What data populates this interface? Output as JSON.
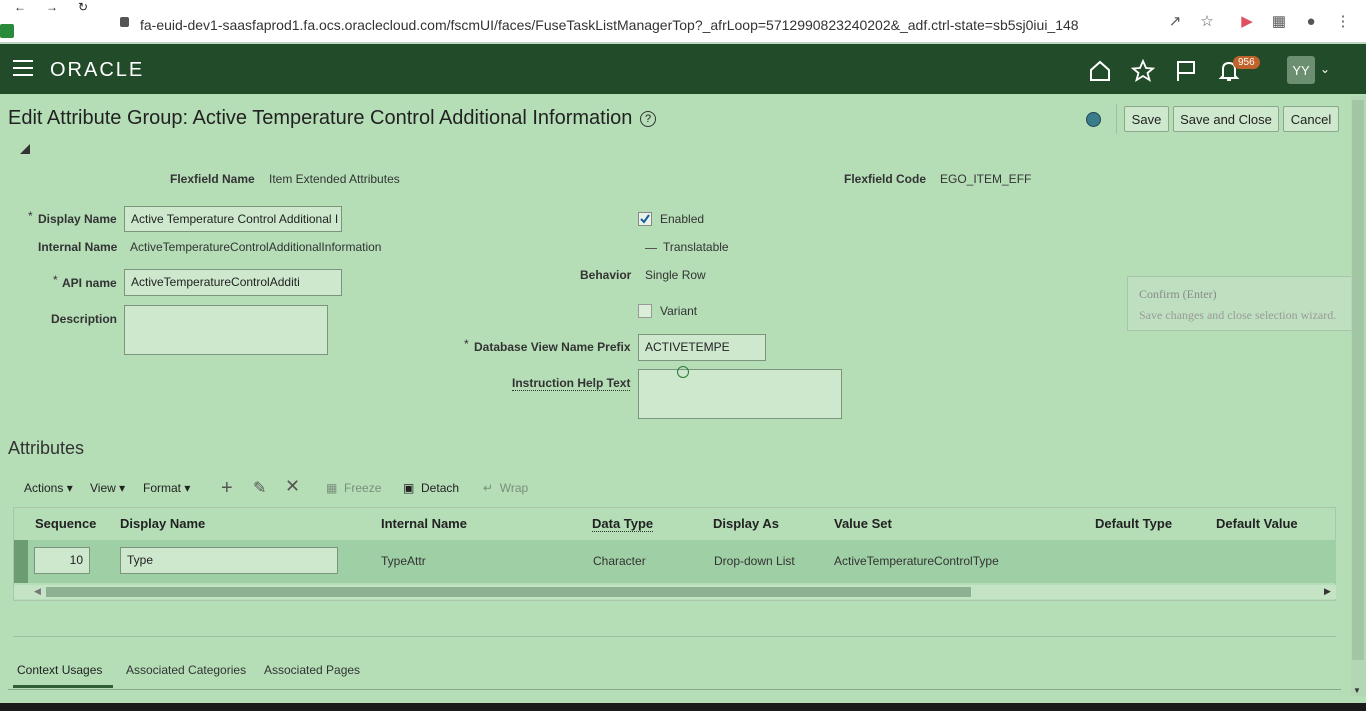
{
  "browser": {
    "url": "fa-euid-dev1-saasfaprod1.fa.ocs.oraclecloud.com/fscmUI/faces/FuseTaskListManagerTop?_afrLoop=5712990823240202&_adf.ctrl-state=sb5sj0iui_148"
  },
  "header": {
    "logo": "ORACLE",
    "notification_count": "956",
    "user_initials": "YY"
  },
  "page": {
    "title": "Edit Attribute Group: Active Temperature Control Additional Information",
    "save_label": "Save",
    "save_close_label": "Save and Close",
    "cancel_label": "Cancel"
  },
  "form": {
    "flexfield_name_label": "Flexfield Name",
    "flexfield_name_value": "Item Extended Attributes",
    "flexfield_code_label": "Flexfield Code",
    "flexfield_code_value": "EGO_ITEM_EFF",
    "display_name_label": "Display Name",
    "display_name_value": "Active Temperature Control Additional I",
    "internal_name_label": "Internal Name",
    "internal_name_value": "ActiveTemperatureControlAdditionalInformation",
    "api_name_label": "API name",
    "api_name_value": "ActiveTemperatureControlAdditi",
    "description_label": "Description",
    "enabled_label": "Enabled",
    "translatable_label": "Translatable",
    "behavior_label": "Behavior",
    "behavior_value": "Single Row",
    "variant_label": "Variant",
    "db_view_prefix_label": "Database View Name Prefix",
    "db_view_prefix_value": "ACTIVETEMPE",
    "instruction_help_label": "Instruction Help Text",
    "required_marker": "*"
  },
  "tooltip": {
    "title": "Confirm (Enter)",
    "text": "Save changes and close selection wizard."
  },
  "attributes": {
    "heading": "Attributes",
    "toolbar": {
      "actions": "Actions",
      "view": "View",
      "format": "Format",
      "freeze": "Freeze",
      "detach": "Detach",
      "wrap": "Wrap"
    },
    "columns": [
      "Sequence",
      "Display Name",
      "Internal Name",
      "Data Type",
      "Display As",
      "Value Set",
      "Default Type",
      "Default Value"
    ],
    "rows": [
      {
        "sequence": "10",
        "display_name": "Type",
        "internal_name": "TypeAttr",
        "data_type": "Character",
        "display_as": "Drop-down List",
        "value_set": "ActiveTemperatureControlType"
      }
    ]
  },
  "tabs": [
    "Context Usages",
    "Associated Categories",
    "Associated Pages"
  ],
  "colors": {
    "header_bg": "#224b29",
    "page_bg": "#b5deb7",
    "badge": "#c0622b"
  }
}
